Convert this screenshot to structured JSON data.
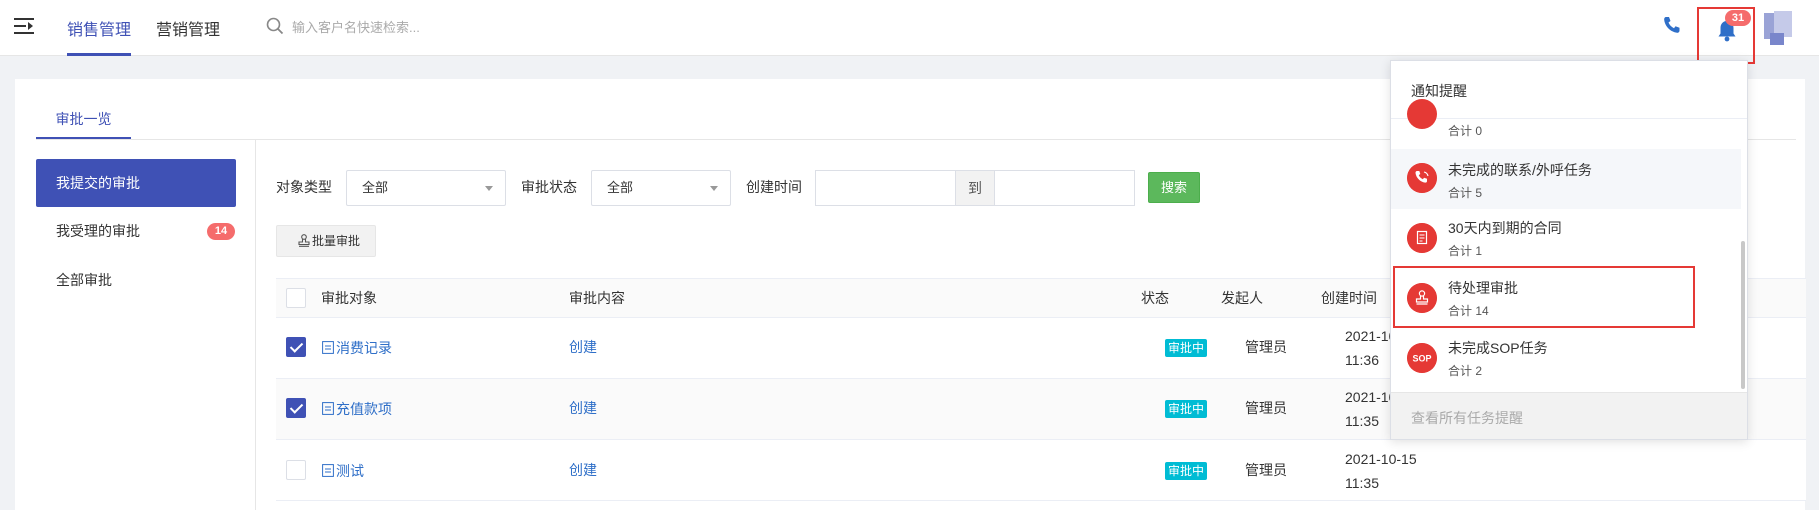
{
  "header": {
    "nav_tabs": [
      {
        "label": "销售管理",
        "active": true
      },
      {
        "label": "营销管理",
        "active": false
      }
    ],
    "search_placeholder": "输入客户名快速检索...",
    "notification_count": "31",
    "accent_color": "#3f51b5"
  },
  "page": {
    "tab_label": "审批一览"
  },
  "sidebar": {
    "items": [
      {
        "label": "我提交的审批",
        "active": true
      },
      {
        "label": "我受理的审批",
        "badge": "14"
      },
      {
        "label": "全部审批"
      }
    ]
  },
  "filters": {
    "object_type_label": "对象类型",
    "object_type_value": "全部",
    "status_label": "审批状态",
    "status_value": "全部",
    "created_time_label": "创建时间",
    "date_to_label": "到",
    "search_button": "搜索",
    "batch_button": "批量审批"
  },
  "table": {
    "columns": [
      "审批对象",
      "审批内容",
      "状态",
      "发起人",
      "创建时间"
    ],
    "rows": [
      {
        "checked": true,
        "object": "消费记录",
        "content": "创建",
        "status": "审批中",
        "initiator": "管理员",
        "created_date": "2021-10-",
        "created_time": "11:36"
      },
      {
        "checked": true,
        "object": "充值款项",
        "content": "创建",
        "status": "审批中",
        "initiator": "管理员",
        "created_date": "2021-10-",
        "created_time": "11:35"
      },
      {
        "checked": false,
        "object": "测试",
        "content": "创建",
        "status": "审批中",
        "initiator": "管理员",
        "created_date": "2021-10-15",
        "created_time": "11:35"
      }
    ],
    "status_color": "#00bcd4"
  },
  "notifications": {
    "title": "通知提醒",
    "items": [
      {
        "label": "",
        "count": "合计 0",
        "icon": "partial-icon"
      },
      {
        "label": "未完成的联系/外呼任务",
        "count": "合计 5",
        "icon": "phone-call-icon"
      },
      {
        "label": "30天内到期的合同",
        "count": "合计 1",
        "icon": "contract-icon"
      },
      {
        "label": "待处理审批",
        "count": "合计 14",
        "icon": "approval-stamp-icon"
      },
      {
        "label": "未完成SOP任务",
        "count": "合计 2",
        "icon": "sop-icon"
      }
    ],
    "footer_link": "查看所有任务提醒",
    "icon_color": "#e53935",
    "highlight_color": "#e53935"
  }
}
